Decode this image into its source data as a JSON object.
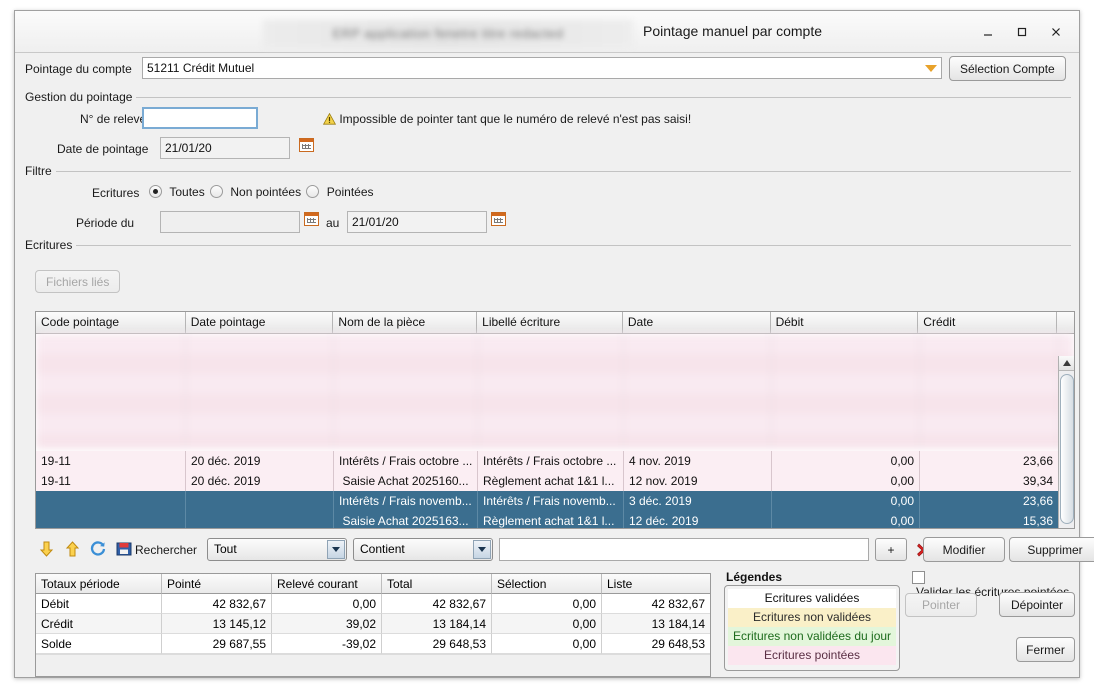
{
  "window": {
    "title": "Pointage manuel par compte",
    "redacted_title": "ERP application fenetre titre redacted",
    "minimize_label": "minimize",
    "maximize_label": "maximize",
    "close_label": "close"
  },
  "account": {
    "label": "Pointage du compte",
    "value": "51211 Crédit Mutuel",
    "select_button": "Sélection Compte"
  },
  "gestion": {
    "group_title": "Gestion du pointage",
    "releve_label": "N° de relevé",
    "releve_value": "",
    "warning": "Impossible de pointer tant que le numéro de relevé n'est pas saisi!",
    "date_label": "Date de pointage",
    "date_value": "21/01/20"
  },
  "filtre": {
    "group_title": "Filtre",
    "ecritures_label": "Ecritures",
    "options": [
      {
        "label": "Toutes",
        "selected": true
      },
      {
        "label": "Non pointées",
        "selected": false
      },
      {
        "label": "Pointées",
        "selected": false
      }
    ],
    "periode_label": "Période du",
    "periode_from": "",
    "au_label": "au",
    "periode_to": "21/01/20"
  },
  "ecritures": {
    "group_title": "Ecritures",
    "files_button": "Fichiers liés",
    "columns": [
      "Code pointage",
      "Date pointage",
      "Nom de la pièce",
      "Libellé écriture",
      "Date",
      "Débit",
      "Crédit"
    ],
    "rows": [
      {
        "state": "pink",
        "code": "19-11",
        "date_pointage": "20 déc. 2019",
        "piece": "Intérêts / Frais octobre ...",
        "libelle": "Intérêts / Frais octobre ...",
        "date": "4 nov. 2019",
        "debit": "0,00",
        "credit": "23,66"
      },
      {
        "state": "pink",
        "code": "19-11",
        "date_pointage": "20 déc. 2019",
        "piece": "Saisie Achat 2025160...",
        "libelle": "Règlement achat 1&1 l...",
        "date": "12 nov. 2019",
        "debit": "0,00",
        "credit": "39,34"
      },
      {
        "state": "selected",
        "code": "",
        "date_pointage": "",
        "piece": "Intérêts / Frais novemb...",
        "libelle": "Intérêts / Frais novemb...",
        "date": "3 déc. 2019",
        "debit": "0,00",
        "credit": "23,66"
      },
      {
        "state": "selected",
        "code": "",
        "date_pointage": "",
        "piece": "Saisie Achat 2025163...",
        "libelle": "Règlement achat 1&1 l...",
        "date": "12 déc. 2019",
        "debit": "0,00",
        "credit": "15,36"
      }
    ]
  },
  "toolbar": {
    "icons": [
      "arrow-down-icon",
      "arrow-up-icon",
      "refresh-icon",
      "save-icon"
    ],
    "search_label": "Rechercher",
    "scope_value": "Tout",
    "operator_value": "Contient",
    "query_value": "",
    "add_label": "+",
    "clear_label": "clear-icon",
    "modify_label": "Modifier",
    "delete_label": "Supprimer"
  },
  "totaux": {
    "columns": [
      "Totaux période",
      "Pointé",
      "Relevé courant",
      "Total",
      "Sélection",
      "Liste"
    ],
    "rows": [
      {
        "label": "Débit",
        "pointe": "42 832,67",
        "releve": "0,00",
        "total": "42 832,67",
        "selection": "0,00",
        "liste": "42 832,67"
      },
      {
        "label": "Crédit",
        "pointe": "13 145,12",
        "releve": "39,02",
        "total": "13 184,14",
        "selection": "0,00",
        "liste": "13 184,14"
      },
      {
        "label": "Solde",
        "pointe": "29 687,55",
        "releve": "-39,02",
        "total": "29 648,53",
        "selection": "0,00",
        "liste": "29 648,53"
      }
    ]
  },
  "legendes": {
    "title": "Légendes",
    "items": [
      {
        "label": "Ecritures validées",
        "color": "#ffffff"
      },
      {
        "label": "Ecritures non validées",
        "color": "#faf0c8"
      },
      {
        "label": "Ecritures non validées du jour",
        "color": "#e3f6db"
      },
      {
        "label": "Ecritures pointées",
        "color": "#fbe6ef"
      }
    ]
  },
  "actions": {
    "validate_checkbox_label": "Valider les écritures pointées",
    "validate_checked": false,
    "pointer_label": "Pointer",
    "depointer_label": "Dépointer",
    "close_label": "Fermer"
  },
  "colors": {
    "selection_blue": "#3b6e8f",
    "pointed_pink": "#fbeef3",
    "warn_yellow": "#e8c11a",
    "accent_orange": "#e8a22a"
  }
}
